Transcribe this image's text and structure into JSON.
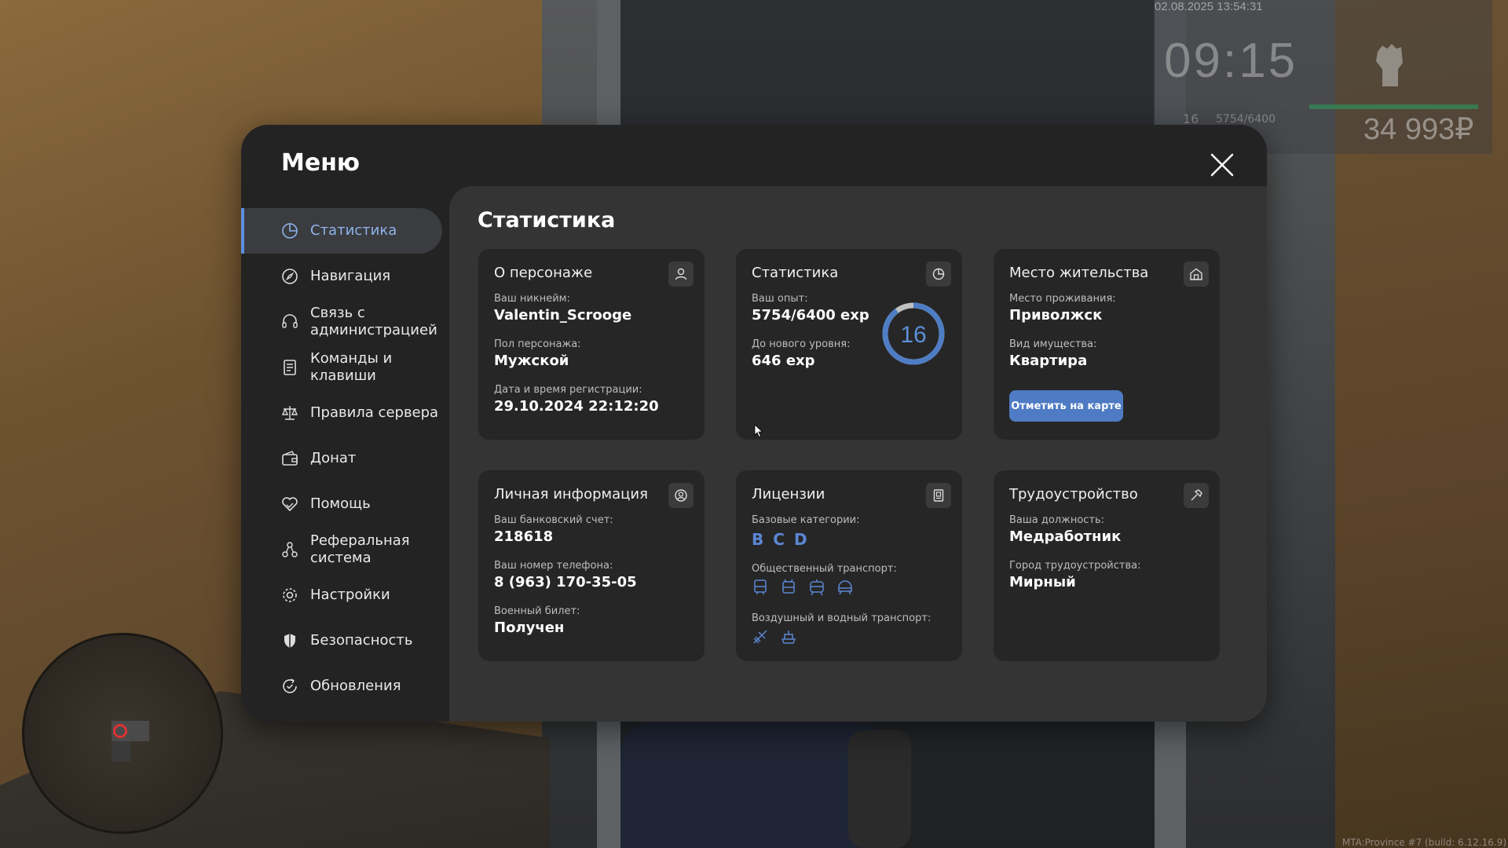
{
  "hud": {
    "datetime": "02.08.2025 13:54:31",
    "time": "09:15",
    "level": "16",
    "exp": "5754/6400",
    "money": "34 993₽",
    "build": "MTA:Province #7 (build: 6.12.16.9)"
  },
  "menu": {
    "title": "Меню",
    "nav": [
      {
        "label": "Статистика",
        "icon": "pie-chart-icon"
      },
      {
        "label": "Навигация",
        "icon": "compass-icon"
      },
      {
        "label": "Связь с администрацией",
        "icon": "headset-icon"
      },
      {
        "label": "Команды и клавиши",
        "icon": "document-list-icon"
      },
      {
        "label": "Правила сервера",
        "icon": "scales-icon"
      },
      {
        "label": "Донат",
        "icon": "wallet-icon"
      },
      {
        "label": "Помощь",
        "icon": "heart-hand-icon"
      },
      {
        "label": "Реферальная система",
        "icon": "network-icon"
      },
      {
        "label": "Настройки",
        "icon": "gear-icon"
      },
      {
        "label": "Безопасность",
        "icon": "shield-icon"
      },
      {
        "label": "Обновления",
        "icon": "refresh-check-icon"
      }
    ]
  },
  "content": {
    "title": "Статистика",
    "about": {
      "title": "О персонаже",
      "nick_label": "Ваш никнейм:",
      "nick": "Valentin_Scrooge",
      "gender_label": "Пол персонажа:",
      "gender": "Мужской",
      "reg_label": "Дата и время регистрации:",
      "reg": "29.10.2024 22:12:20"
    },
    "stats": {
      "title": "Статистика",
      "exp_label": "Ваш опыт:",
      "exp": "5754/6400 exp",
      "next_label": "До нового уровня:",
      "next": "646 exp",
      "level": "16",
      "progress": 0.899
    },
    "residence": {
      "title": "Место жительства",
      "place_label": "Место проживания:",
      "place": "Приволжск",
      "prop_label": "Вид имущества:",
      "prop": "Квартира",
      "button": "Отметить на карте"
    },
    "personal": {
      "title": "Личная информация",
      "bank_label": "Ваш банковский счет:",
      "bank": "218618",
      "phone_label": "Ваш номер телефона:",
      "phone": "8 (963) 170-35-05",
      "military_label": "Военный билет:",
      "military": "Получен"
    },
    "licenses": {
      "title": "Лицензии",
      "base_label": "Базовые категории:",
      "categories": [
        "B",
        "C",
        "D"
      ],
      "public_label": "Общественный транспорт:",
      "air_label": "Воздушный и водный транспорт:"
    },
    "job": {
      "title": "Трудоустройство",
      "position_label": "Ваша должность:",
      "position": "Медработник",
      "city_label": "Город трудоустройства:",
      "city": "Мирный"
    }
  },
  "colors": {
    "accent": "#5b8fe0",
    "button": "#4e7bc3",
    "license": "#5b87d3"
  }
}
